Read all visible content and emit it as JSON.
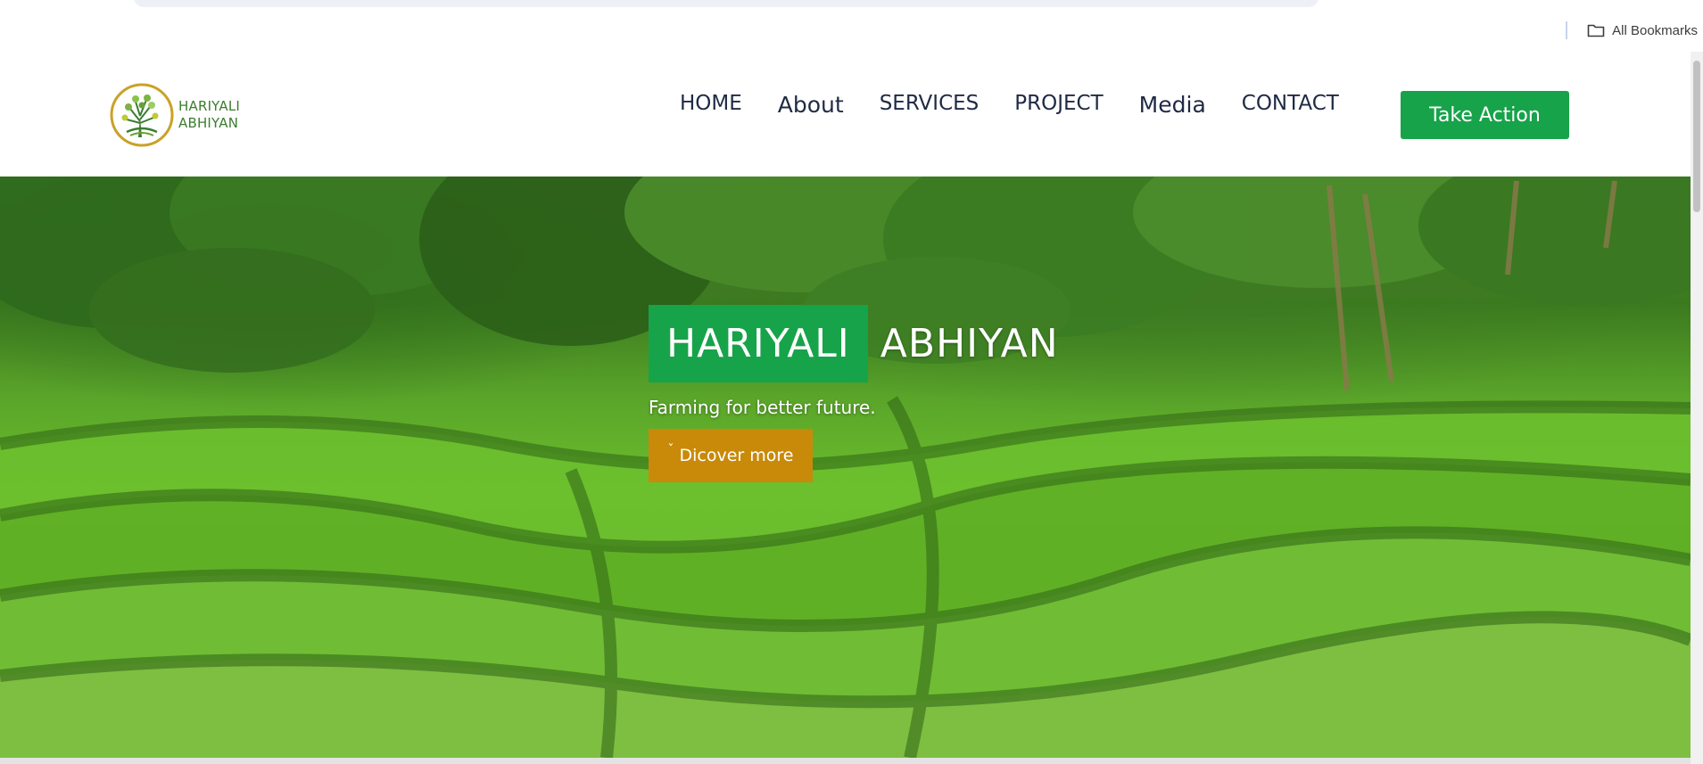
{
  "browser": {
    "bookmarks_label": "All Bookmarks",
    "bookmarks_icon": "folder-icon"
  },
  "header": {
    "logo_line1": "HARIYALI",
    "logo_line2": "ABHIYAN",
    "nav": [
      {
        "label": "HOME"
      },
      {
        "label": "About"
      },
      {
        "label": "SERVICES"
      },
      {
        "label": "PROJECT"
      },
      {
        "label": "Media"
      },
      {
        "label": "CONTACT"
      }
    ],
    "cta_label": "Take Action"
  },
  "hero": {
    "title_highlight": "HARIYALI",
    "title_rest": "ABHIYAN",
    "subtitle": "Farming for better future.",
    "button_icon": "chevron-down-icon",
    "button_label": "Dicover more"
  },
  "colors": {
    "brand_green": "#17a34a",
    "button_orange": "#c98a0a",
    "nav_text": "#1f2a44"
  }
}
